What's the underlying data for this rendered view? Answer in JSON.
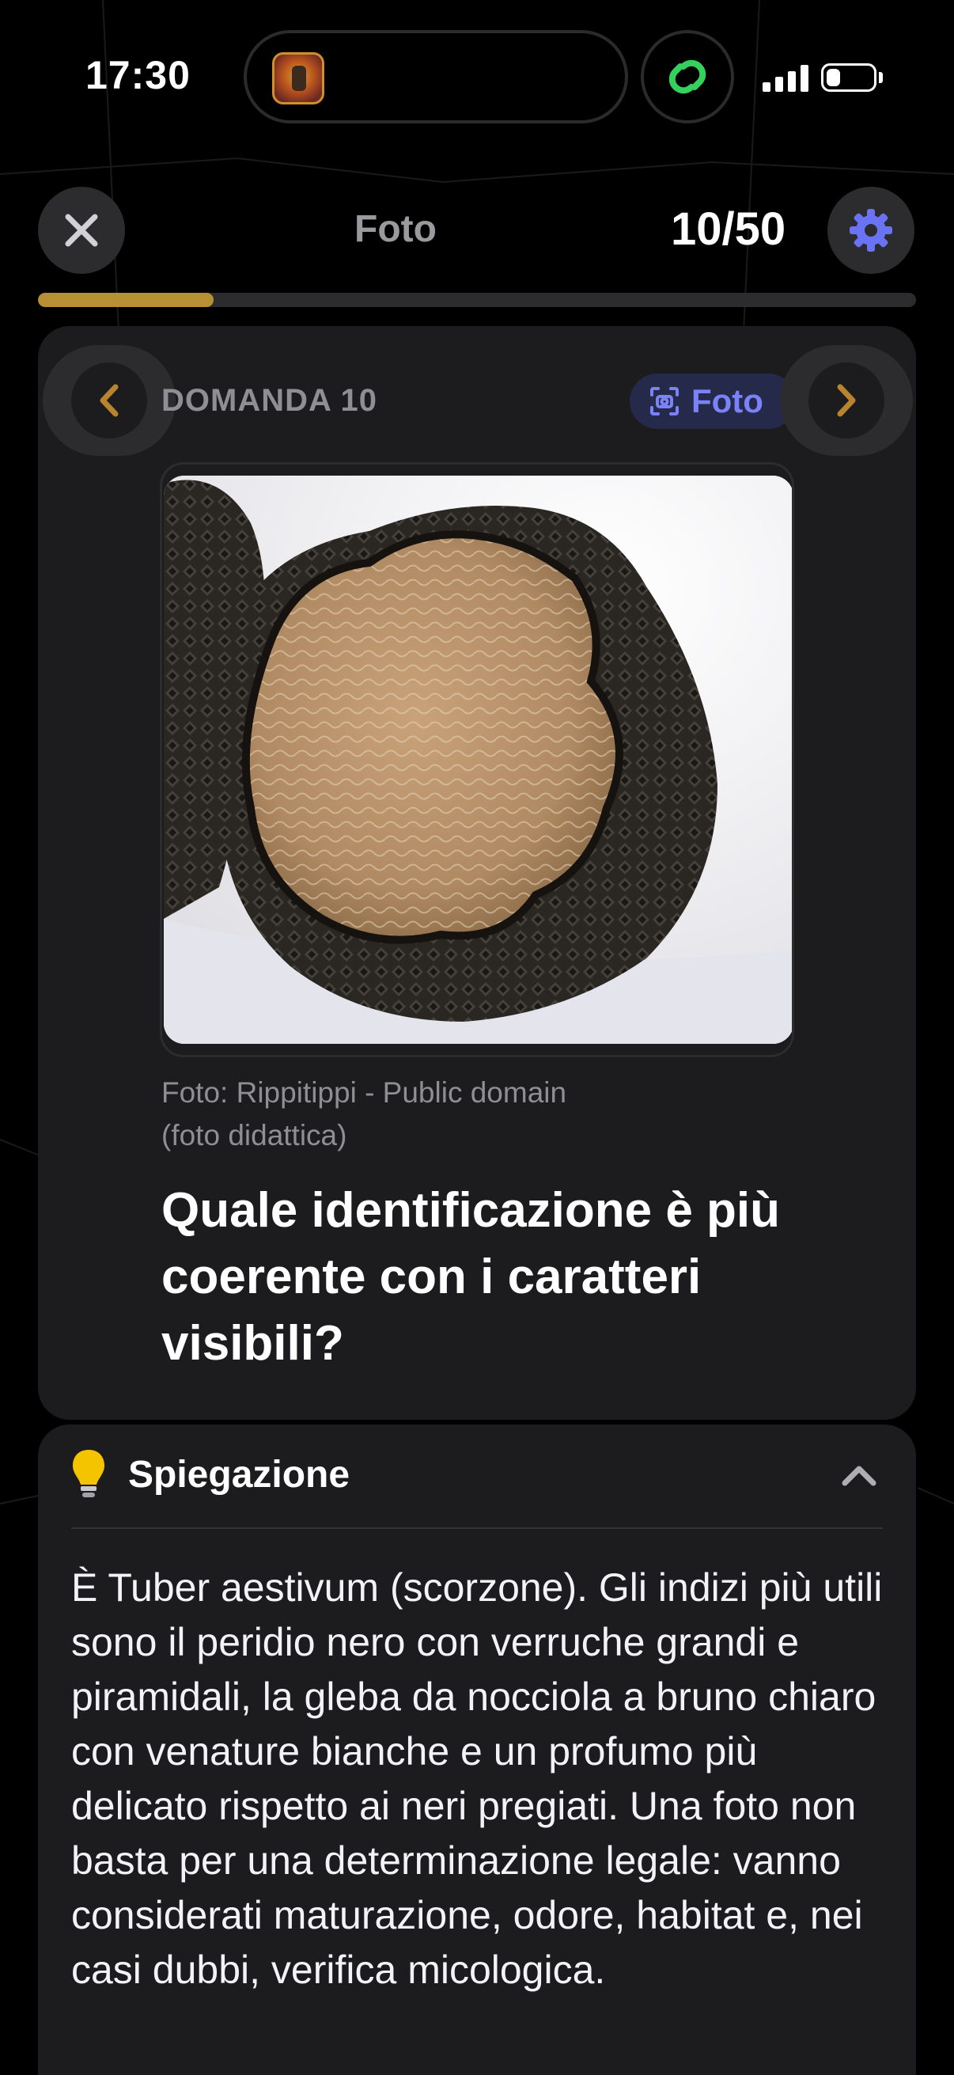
{
  "status_bar": {
    "time": "17:30",
    "battery_level": 0.3
  },
  "header": {
    "title": "Foto",
    "counter": "10/50",
    "progress_fraction": 0.2,
    "colors": {
      "progress": "#b89034",
      "accent": "#6b73f5"
    }
  },
  "question": {
    "label": "DOMANDA 10",
    "type_badge": "Foto",
    "photo_subject": "black-truffle-cross-section",
    "credit_line1": "Foto: Rippitippi - Public domain",
    "credit_line2": "(foto didattica)",
    "text": "Quale identificazione è più coerente con i caratteri visibili?"
  },
  "explanation": {
    "title": "Spiegazione",
    "icon": "lightbulb-icon",
    "body": "È Tuber aestivum (scorzone). Gli indizi più utili sono il peridio nero con verruche grandi e piramidali, la gleba da nocciola a bruno chiaro con venature bianche e un profumo più delicato rispetto ai neri pregiati. Una foto non basta per una determinazione legale: vanno considerati maturazione, odore, habitat e, nei casi dubbi, verifica micologica."
  }
}
